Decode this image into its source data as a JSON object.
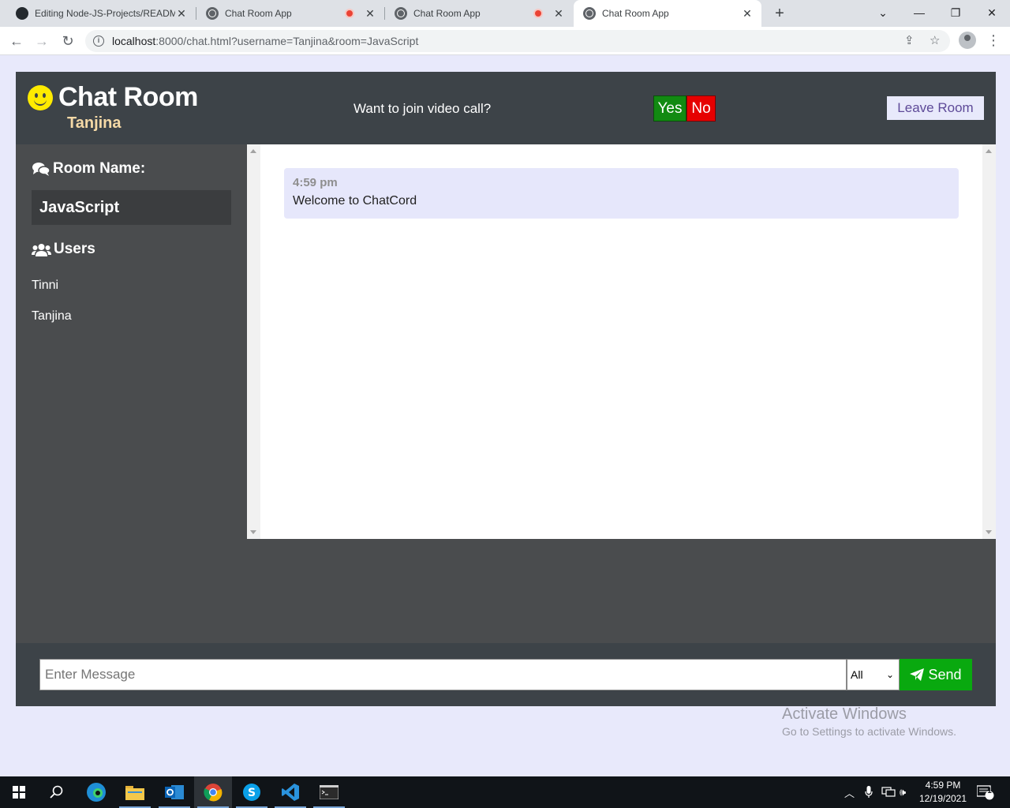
{
  "browser": {
    "tabs": [
      {
        "title": "Editing Node-JS-Projects/READM",
        "favicon": "github-icon",
        "recording": false
      },
      {
        "title": "Chat Room App",
        "favicon": "globe-icon",
        "recording": true
      },
      {
        "title": "Chat Room App",
        "favicon": "globe-icon",
        "recording": true
      },
      {
        "title": "Chat Room App",
        "favicon": "globe-icon",
        "recording": false,
        "active": true
      }
    ],
    "url_host": "localhost",
    "url_rest": ":8000/chat.html?username=Tanjina&room=JavaScript"
  },
  "header": {
    "title": "Chat Room",
    "username": "Tanjina",
    "video_prompt": "Want to join video call?",
    "yes_label": "Yes",
    "no_label": "No",
    "leave_label": "Leave Room"
  },
  "sidebar": {
    "room_heading": "Room Name:",
    "room_name": "JavaScript",
    "users_heading": "Users",
    "users": [
      "Tinni",
      "Tanjina"
    ]
  },
  "messages": [
    {
      "time": "4:59 pm",
      "text": "Welcome to ChatCord"
    }
  ],
  "form": {
    "placeholder": "Enter Message",
    "recipient": "All",
    "send_label": "Send"
  },
  "watermark": {
    "line1": "Activate Windows",
    "line2": "Go to Settings to activate Windows."
  },
  "taskbar": {
    "time": "4:59 PM",
    "date": "12/19/2021",
    "notification_count": "1"
  },
  "colors": {
    "header_bg": "#3d4348",
    "sidebar_bg": "#4a4c4e",
    "message_bg": "#e6e7fb",
    "yes_green": "#128a12",
    "no_red": "#e60000",
    "send_green": "#09a90f",
    "username_color": "#f5d9a6"
  }
}
